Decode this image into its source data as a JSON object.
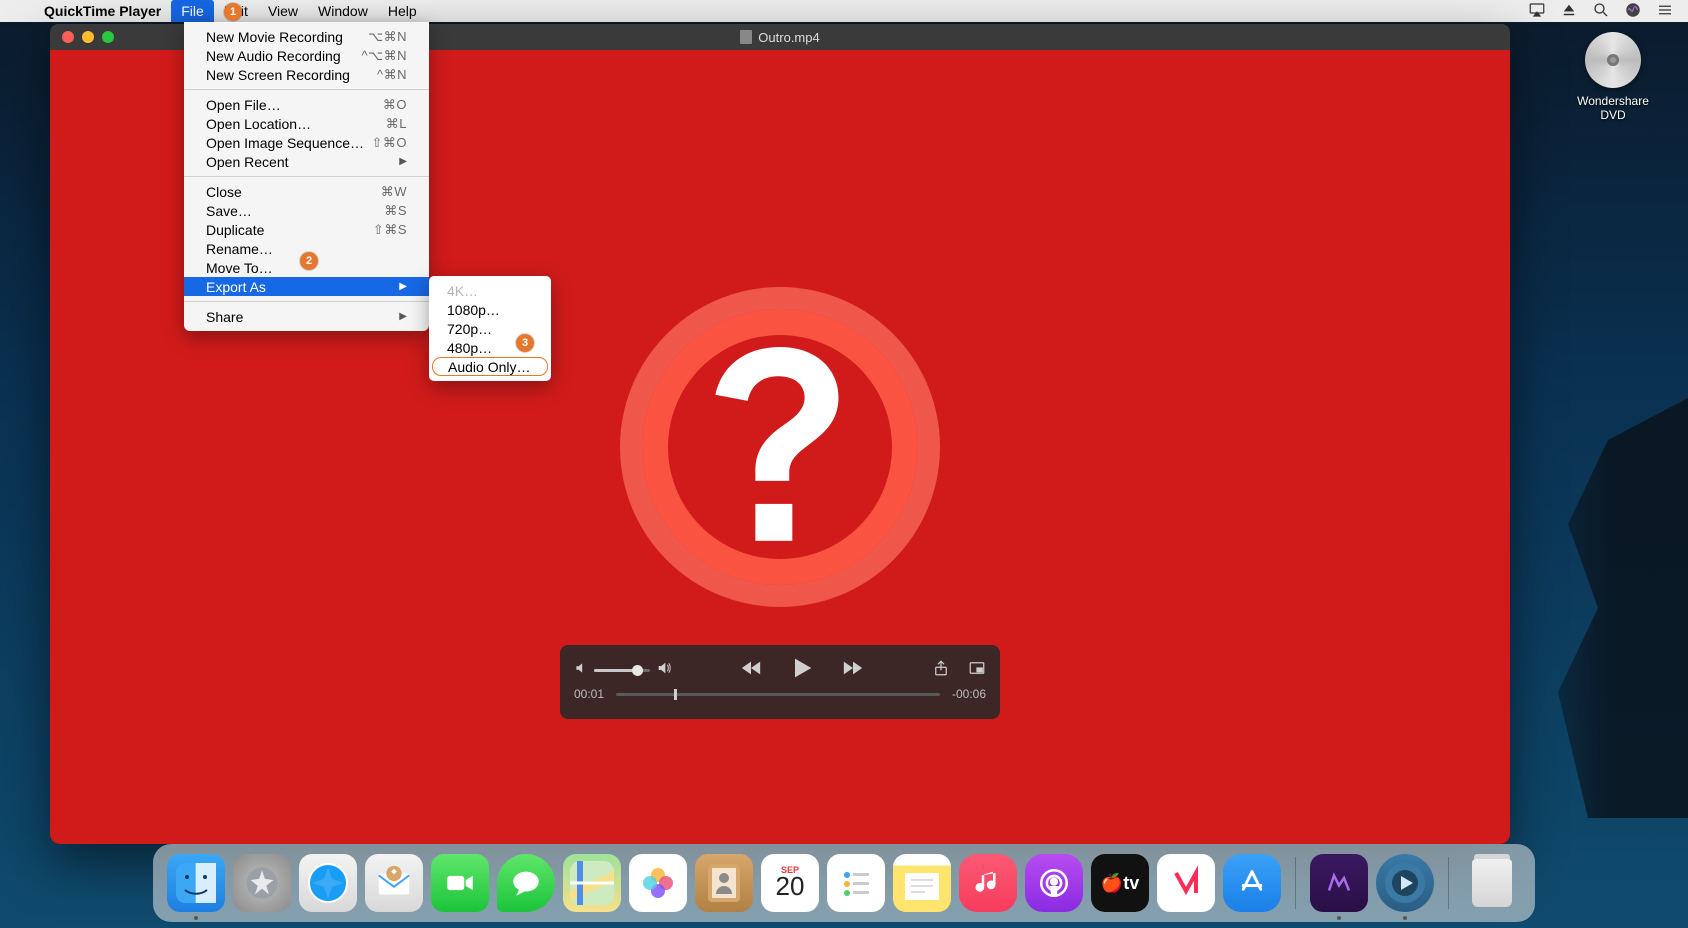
{
  "menubar": {
    "app_name": "QuickTime Player",
    "items": [
      "File",
      "Edit",
      "View",
      "Window",
      "Help"
    ],
    "active_index": 0
  },
  "file_menu": {
    "groups": [
      [
        {
          "label": "New Movie Recording",
          "shortcut": "⌥⌘N"
        },
        {
          "label": "New Audio Recording",
          "shortcut": "^⌥⌘N"
        },
        {
          "label": "New Screen Recording",
          "shortcut": "^⌘N"
        }
      ],
      [
        {
          "label": "Open File…",
          "shortcut": "⌘O"
        },
        {
          "label": "Open Location…",
          "shortcut": "⌘L"
        },
        {
          "label": "Open Image Sequence…",
          "shortcut": "⇧⌘O"
        },
        {
          "label": "Open Recent",
          "submenu": true
        }
      ],
      [
        {
          "label": "Close",
          "shortcut": "⌘W"
        },
        {
          "label": "Save…",
          "shortcut": "⌘S"
        },
        {
          "label": "Duplicate",
          "shortcut": "⇧⌘S"
        },
        {
          "label": "Rename…"
        },
        {
          "label": "Move To…"
        },
        {
          "label": "Export As",
          "submenu": true,
          "highlighted": true
        }
      ],
      [
        {
          "label": "Share",
          "submenu": true
        }
      ]
    ]
  },
  "export_submenu": {
    "items": [
      {
        "label": "4K…",
        "disabled": true
      },
      {
        "label": "1080p…"
      },
      {
        "label": "720p…"
      },
      {
        "label": "480p…"
      },
      {
        "label": "Audio Only…",
        "boxed": true
      }
    ]
  },
  "annotations": {
    "a1": "1",
    "a2": "2",
    "a3": "3"
  },
  "window": {
    "title": "Outro.mp4"
  },
  "playback": {
    "elapsed": "00:01",
    "remaining": "-00:06"
  },
  "calendar_icon": {
    "month": "SEP",
    "day": "20"
  },
  "desktop_icon": {
    "label": "Wondershare DVD"
  },
  "dock_names": [
    "finder",
    "launchpad",
    "safari",
    "mail",
    "facetime",
    "messages",
    "maps",
    "photos",
    "contacts",
    "calendar",
    "reminders",
    "notes",
    "music",
    "podcasts",
    "tv",
    "news",
    "appstore",
    "purple",
    "qt",
    "trash"
  ]
}
